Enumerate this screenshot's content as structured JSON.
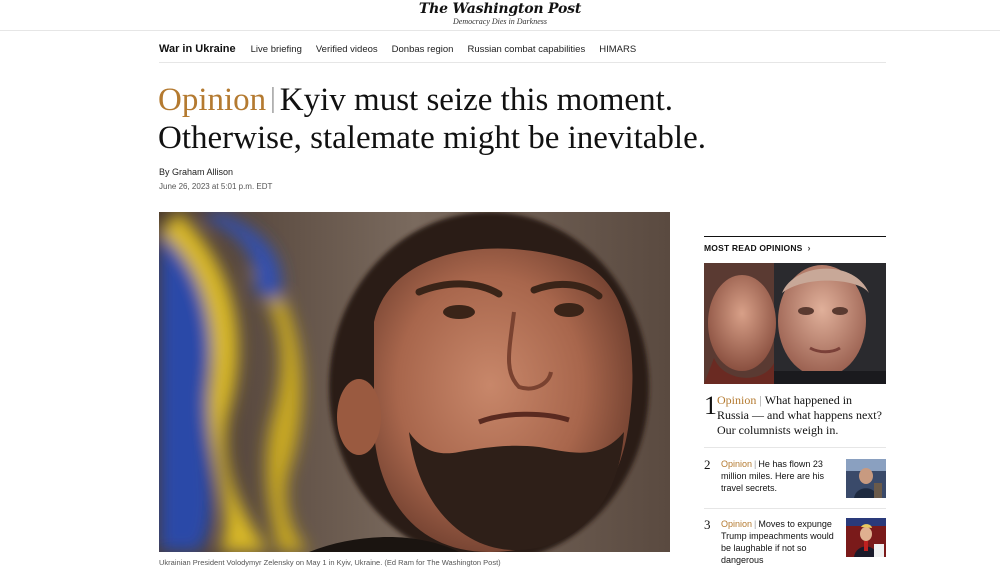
{
  "masthead": {
    "logo": "The Washington Post",
    "tagline": "Democracy Dies in Darkness"
  },
  "nav": {
    "section_title": "War in Ukraine",
    "links": [
      "Live briefing",
      "Verified videos",
      "Donbas region",
      "Russian combat capabilities",
      "HIMARS"
    ]
  },
  "article": {
    "kicker": "Opinion",
    "headline": "Kyiv must seize this moment. Otherwise, stalemate might be inevitable.",
    "byline_prefix": "By",
    "author": "Graham Allison",
    "date": "June 26, 2023 at 5:01 p.m. EDT",
    "image_caption": "Ukrainian President Volodymyr Zelensky on May 1 in Kyiv, Ukraine. (Ed Ram for The Washington Post)"
  },
  "most_read": {
    "heading": "MOST READ OPINIONS",
    "items": [
      {
        "rank": "1",
        "kicker": "Opinion",
        "title": "What happened in Russia — and what happens next? Our columnists weigh in."
      },
      {
        "rank": "2",
        "kicker": "Opinion",
        "title": "He has flown 23 million miles. Here are his travel secrets."
      },
      {
        "rank": "3",
        "kicker": "Opinion",
        "title": "Moves to expunge Trump impeachments would be laughable if not so dangerous"
      }
    ]
  },
  "colors": {
    "opinion_accent": "#b47a30",
    "divider": "#e6e6e6",
    "text": "#111111"
  },
  "icons": {
    "most_read_chevron": "chevron-right-icon"
  }
}
